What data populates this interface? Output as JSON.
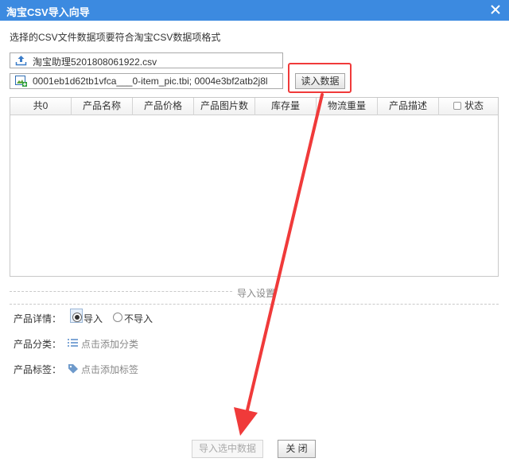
{
  "window": {
    "title": "淘宝CSV导入向导"
  },
  "hint": "选择的CSV文件数据项要符合淘宝CSV数据项格式",
  "files": {
    "csv": "淘宝助理5201808061922.csv",
    "images": "0001eb1d62tb1vfca___0-item_pic.tbi; 0004e3bf2atb2j8l"
  },
  "read_button": "读入数据",
  "table": {
    "columns": [
      "共0",
      "产品名称",
      "产品价格",
      "产品图片数",
      "库存量",
      "物流重量",
      "产品描述",
      "状态"
    ]
  },
  "settings": {
    "section_title": "导入设置",
    "detail_label": "产品详情：",
    "detail_options": [
      "导入",
      "不导入"
    ],
    "detail_selected": "导入",
    "category_label": "产品分类：",
    "category_link": "点击添加分类",
    "tags_label": "产品标签：",
    "tags_link": "点击添加标签"
  },
  "footer": {
    "import_selected": "导入选中数据",
    "close": "关 闭"
  },
  "colors": {
    "titlebar": "#3c8ae0",
    "annotation": "#f03a3a"
  }
}
